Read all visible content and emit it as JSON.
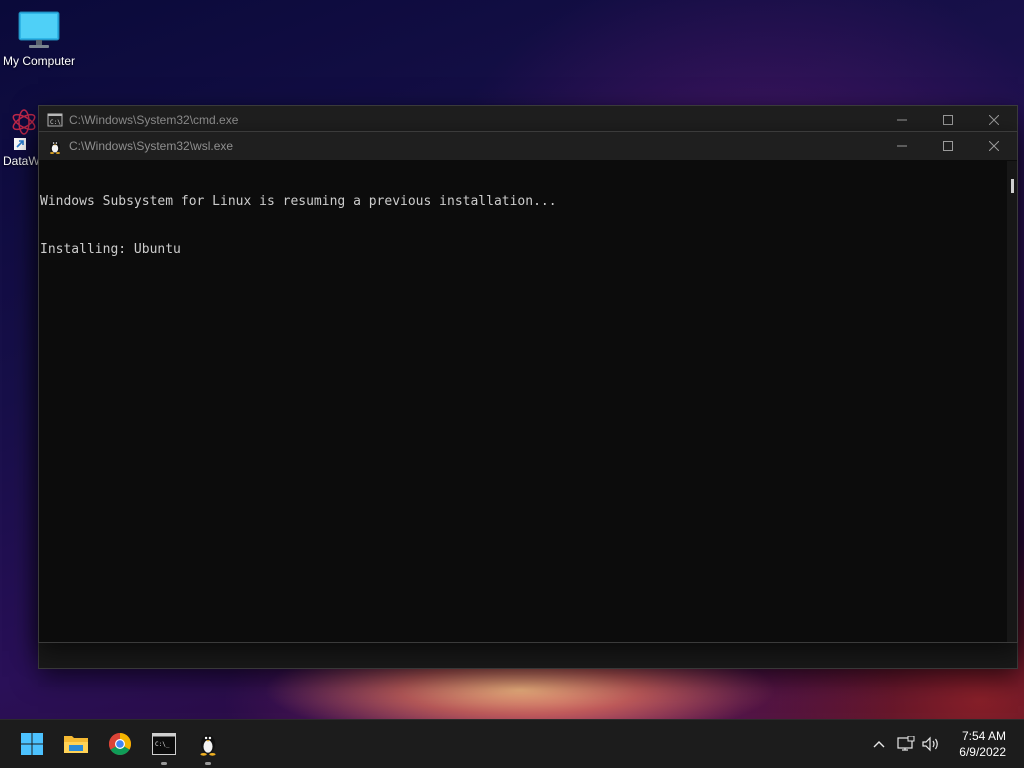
{
  "desktop": {
    "icons": [
      {
        "label": "My Computer"
      },
      {
        "label": "DataW"
      }
    ]
  },
  "windows": {
    "cmd": {
      "title": "C:\\Windows\\System32\\cmd.exe",
      "minimize_glyph": "—",
      "maximize_glyph": "☐",
      "close_glyph": "✕"
    },
    "wsl": {
      "title": "C:\\Windows\\System32\\wsl.exe",
      "minimize_glyph": "—",
      "maximize_glyph": "☐",
      "close_glyph": "✕",
      "lines": [
        "Windows Subsystem for Linux is resuming a previous installation...",
        "Installing: Ubuntu"
      ]
    }
  },
  "taskbar": {
    "apps": [
      {
        "icon": "windows-start-icon"
      },
      {
        "icon": "file-explorer-icon"
      },
      {
        "icon": "chrome-icon"
      },
      {
        "icon": "terminal-icon",
        "running": true
      },
      {
        "icon": "linux-penguin-icon",
        "running": true
      }
    ],
    "tray": {
      "chevron": "^",
      "network_icon": "network-icon",
      "volume_icon": "volume-icon"
    },
    "clock": {
      "time": "7:54 AM",
      "date": "6/9/2022"
    }
  },
  "colors": {
    "console_bg": "#0c0c0c",
    "console_fg": "#cccccc",
    "titlebar_bg": "#1f1f1f",
    "taskbar_bg": "#1c1c1c",
    "start_blue": "#4cc2ff"
  }
}
